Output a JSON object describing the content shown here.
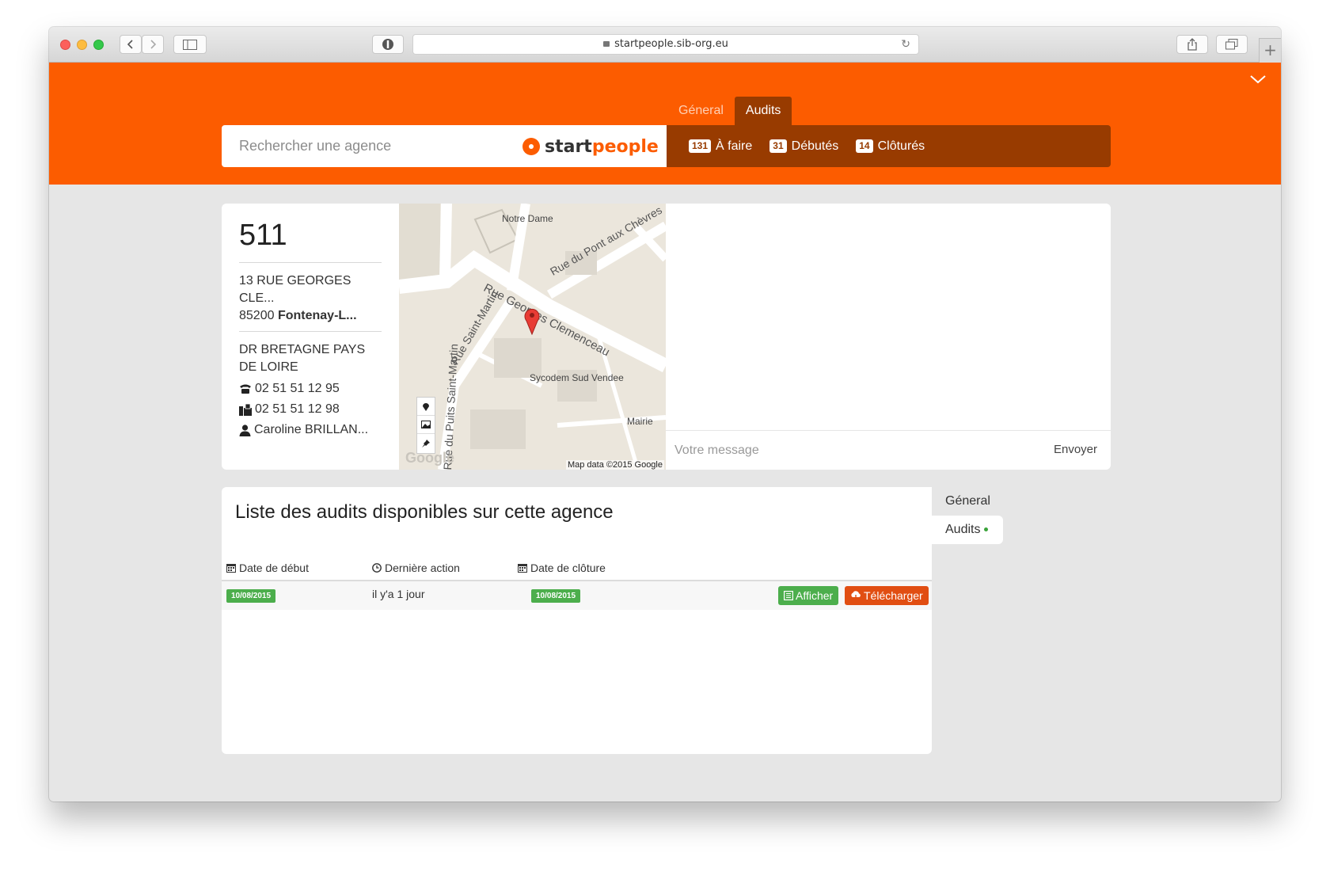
{
  "browser": {
    "url": "startpeople.sib-org.eu"
  },
  "header": {
    "tabs": [
      {
        "label": "Géneral",
        "active": false
      },
      {
        "label": "Audits",
        "active": true
      }
    ],
    "search_placeholder": "Rechercher une agence",
    "logo": {
      "start": "start",
      "people": "people"
    },
    "stats": [
      {
        "count": "131",
        "label": "À faire"
      },
      {
        "count": "31",
        "label": "Débutés"
      },
      {
        "count": "14",
        "label": "Clôturés"
      }
    ],
    "accent_color": "#fc5c00",
    "dark_color": "#983b00"
  },
  "agency": {
    "code": "511",
    "address_line1": "13 RUE GEORGES",
    "address_line2": "CLE...",
    "postal_code": "85200",
    "city": "Fontenay-L...",
    "region": "DR BRETAGNE PAYS DE LOIRE",
    "phone": "02 51 51 12 95",
    "fax": "02 51 51 12 98",
    "contact": "Caroline BRILLAN..."
  },
  "map": {
    "labels": {
      "notre_dame": "Notre Dame",
      "rue_pont": "Rue du Pont aux Chèvres",
      "rue_clemenceau": "Rue Georges Clemenceau",
      "rue_saint_martin": "Rue Saint-Martin",
      "rue_puits": "Rue du Puits Saint-Martin",
      "sycodem": "Sycodem Sud Vendee",
      "mairie": "Mairie"
    },
    "attribution": "Map data ©2015 Google",
    "logo": "Google"
  },
  "message": {
    "placeholder": "Votre message",
    "send_label": "Envoyer"
  },
  "audits": {
    "title": "Liste des audits disponibles sur cette agence",
    "columns": [
      "Date de début",
      "Dernière action",
      "Date de clôture"
    ],
    "rows": [
      {
        "start": "10/08/2015",
        "last_action": "il y'a 1 jour",
        "close": "10/08/2015"
      }
    ],
    "view_label": "Afficher",
    "download_label": "Télécharger"
  },
  "side_nav": {
    "items": [
      {
        "label": "Géneral",
        "active": false
      },
      {
        "label": "Audits",
        "active": true
      }
    ]
  }
}
